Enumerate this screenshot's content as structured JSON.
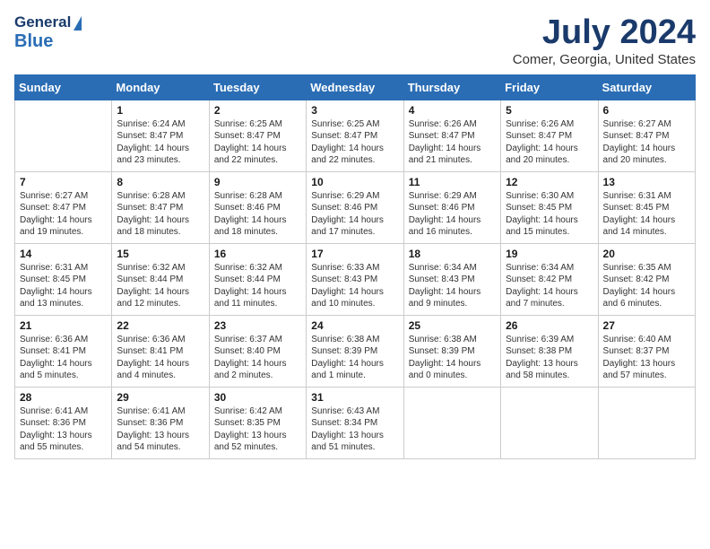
{
  "header": {
    "logo_general": "General",
    "logo_blue": "Blue",
    "title": "July 2024",
    "subtitle": "Comer, Georgia, United States"
  },
  "weekdays": [
    "Sunday",
    "Monday",
    "Tuesday",
    "Wednesday",
    "Thursday",
    "Friday",
    "Saturday"
  ],
  "weeks": [
    [
      {
        "num": "",
        "detail": ""
      },
      {
        "num": "1",
        "detail": "Sunrise: 6:24 AM\nSunset: 8:47 PM\nDaylight: 14 hours\nand 23 minutes."
      },
      {
        "num": "2",
        "detail": "Sunrise: 6:25 AM\nSunset: 8:47 PM\nDaylight: 14 hours\nand 22 minutes."
      },
      {
        "num": "3",
        "detail": "Sunrise: 6:25 AM\nSunset: 8:47 PM\nDaylight: 14 hours\nand 22 minutes."
      },
      {
        "num": "4",
        "detail": "Sunrise: 6:26 AM\nSunset: 8:47 PM\nDaylight: 14 hours\nand 21 minutes."
      },
      {
        "num": "5",
        "detail": "Sunrise: 6:26 AM\nSunset: 8:47 PM\nDaylight: 14 hours\nand 20 minutes."
      },
      {
        "num": "6",
        "detail": "Sunrise: 6:27 AM\nSunset: 8:47 PM\nDaylight: 14 hours\nand 20 minutes."
      }
    ],
    [
      {
        "num": "7",
        "detail": "Sunrise: 6:27 AM\nSunset: 8:47 PM\nDaylight: 14 hours\nand 19 minutes."
      },
      {
        "num": "8",
        "detail": "Sunrise: 6:28 AM\nSunset: 8:47 PM\nDaylight: 14 hours\nand 18 minutes."
      },
      {
        "num": "9",
        "detail": "Sunrise: 6:28 AM\nSunset: 8:46 PM\nDaylight: 14 hours\nand 18 minutes."
      },
      {
        "num": "10",
        "detail": "Sunrise: 6:29 AM\nSunset: 8:46 PM\nDaylight: 14 hours\nand 17 minutes."
      },
      {
        "num": "11",
        "detail": "Sunrise: 6:29 AM\nSunset: 8:46 PM\nDaylight: 14 hours\nand 16 minutes."
      },
      {
        "num": "12",
        "detail": "Sunrise: 6:30 AM\nSunset: 8:45 PM\nDaylight: 14 hours\nand 15 minutes."
      },
      {
        "num": "13",
        "detail": "Sunrise: 6:31 AM\nSunset: 8:45 PM\nDaylight: 14 hours\nand 14 minutes."
      }
    ],
    [
      {
        "num": "14",
        "detail": "Sunrise: 6:31 AM\nSunset: 8:45 PM\nDaylight: 14 hours\nand 13 minutes."
      },
      {
        "num": "15",
        "detail": "Sunrise: 6:32 AM\nSunset: 8:44 PM\nDaylight: 14 hours\nand 12 minutes."
      },
      {
        "num": "16",
        "detail": "Sunrise: 6:32 AM\nSunset: 8:44 PM\nDaylight: 14 hours\nand 11 minutes."
      },
      {
        "num": "17",
        "detail": "Sunrise: 6:33 AM\nSunset: 8:43 PM\nDaylight: 14 hours\nand 10 minutes."
      },
      {
        "num": "18",
        "detail": "Sunrise: 6:34 AM\nSunset: 8:43 PM\nDaylight: 14 hours\nand 9 minutes."
      },
      {
        "num": "19",
        "detail": "Sunrise: 6:34 AM\nSunset: 8:42 PM\nDaylight: 14 hours\nand 7 minutes."
      },
      {
        "num": "20",
        "detail": "Sunrise: 6:35 AM\nSunset: 8:42 PM\nDaylight: 14 hours\nand 6 minutes."
      }
    ],
    [
      {
        "num": "21",
        "detail": "Sunrise: 6:36 AM\nSunset: 8:41 PM\nDaylight: 14 hours\nand 5 minutes."
      },
      {
        "num": "22",
        "detail": "Sunrise: 6:36 AM\nSunset: 8:41 PM\nDaylight: 14 hours\nand 4 minutes."
      },
      {
        "num": "23",
        "detail": "Sunrise: 6:37 AM\nSunset: 8:40 PM\nDaylight: 14 hours\nand 2 minutes."
      },
      {
        "num": "24",
        "detail": "Sunrise: 6:38 AM\nSunset: 8:39 PM\nDaylight: 14 hours\nand 1 minute."
      },
      {
        "num": "25",
        "detail": "Sunrise: 6:38 AM\nSunset: 8:39 PM\nDaylight: 14 hours\nand 0 minutes."
      },
      {
        "num": "26",
        "detail": "Sunrise: 6:39 AM\nSunset: 8:38 PM\nDaylight: 13 hours\nand 58 minutes."
      },
      {
        "num": "27",
        "detail": "Sunrise: 6:40 AM\nSunset: 8:37 PM\nDaylight: 13 hours\nand 57 minutes."
      }
    ],
    [
      {
        "num": "28",
        "detail": "Sunrise: 6:41 AM\nSunset: 8:36 PM\nDaylight: 13 hours\nand 55 minutes."
      },
      {
        "num": "29",
        "detail": "Sunrise: 6:41 AM\nSunset: 8:36 PM\nDaylight: 13 hours\nand 54 minutes."
      },
      {
        "num": "30",
        "detail": "Sunrise: 6:42 AM\nSunset: 8:35 PM\nDaylight: 13 hours\nand 52 minutes."
      },
      {
        "num": "31",
        "detail": "Sunrise: 6:43 AM\nSunset: 8:34 PM\nDaylight: 13 hours\nand 51 minutes."
      },
      {
        "num": "",
        "detail": ""
      },
      {
        "num": "",
        "detail": ""
      },
      {
        "num": "",
        "detail": ""
      }
    ]
  ]
}
